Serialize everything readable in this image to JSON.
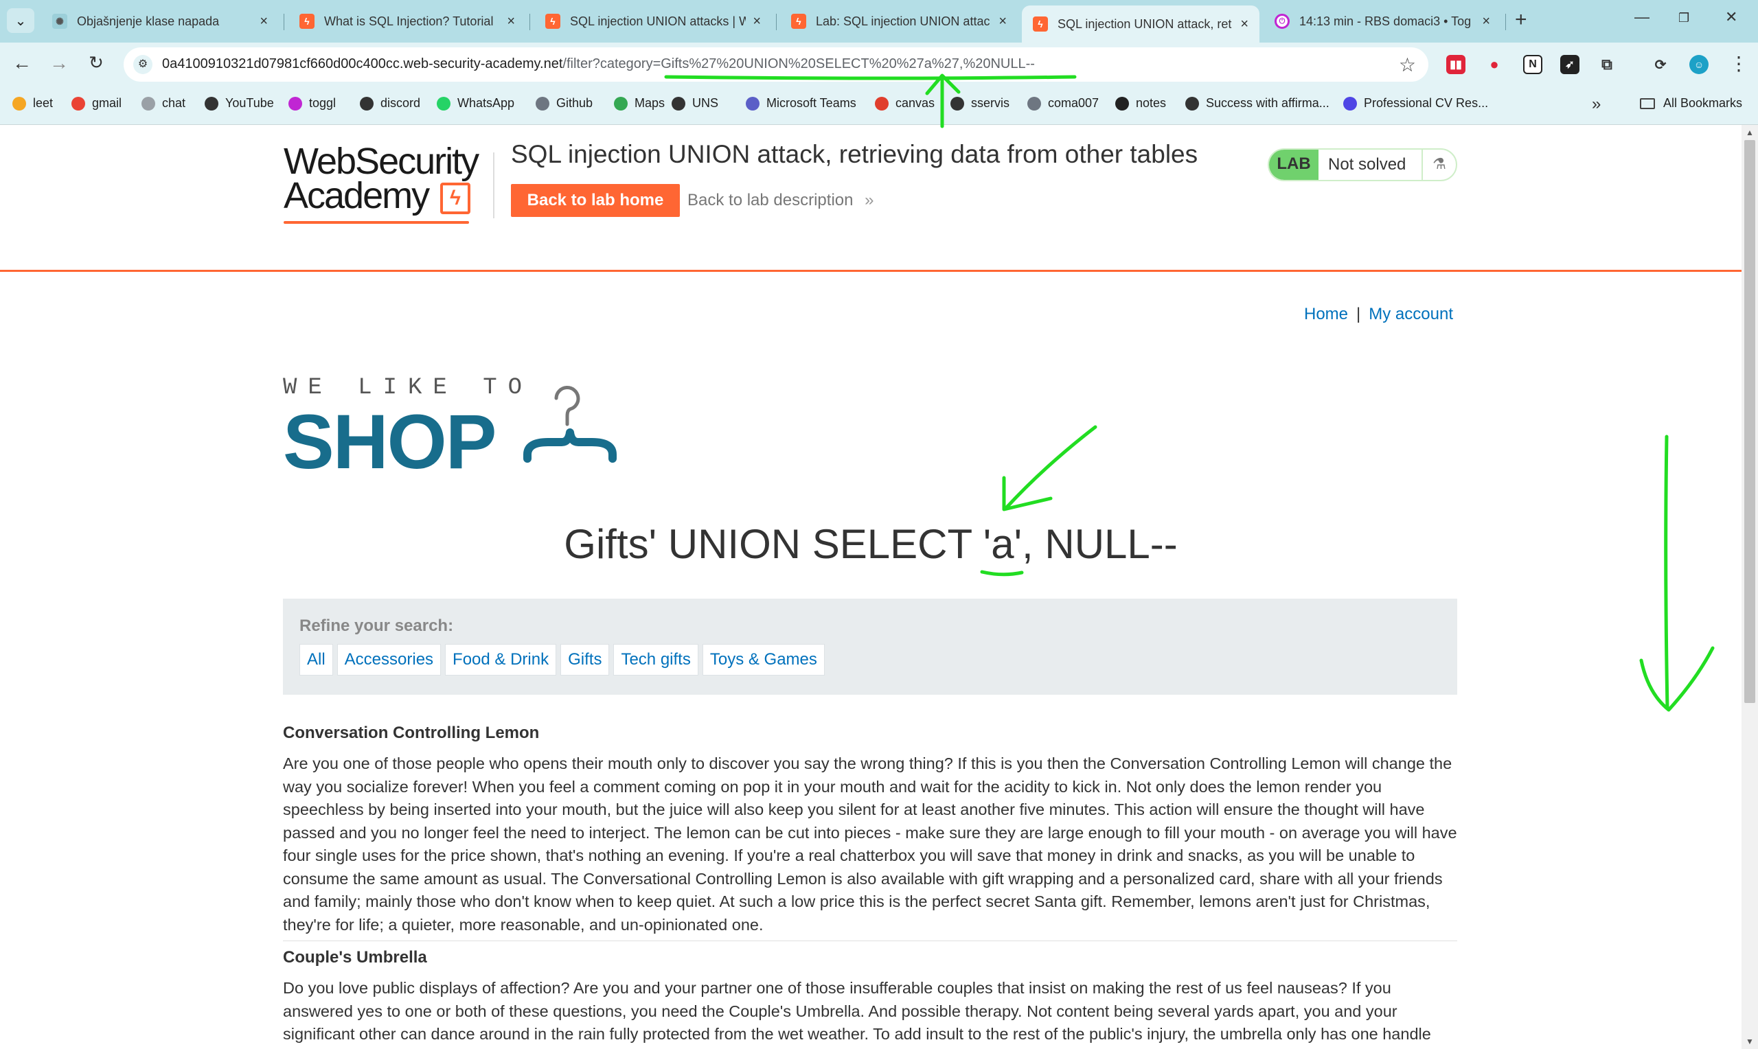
{
  "browser": {
    "tabs": [
      {
        "title": "Objašnjenje klase napada",
        "icon": "chatgpt-icon",
        "active": false
      },
      {
        "title": "What is SQL Injection? Tutorial",
        "icon": "portswigger-icon",
        "active": false
      },
      {
        "title": "SQL injection UNION attacks | W",
        "icon": "portswigger-icon",
        "active": false
      },
      {
        "title": "Lab: SQL injection UNION attac",
        "icon": "portswigger-icon",
        "active": false
      },
      {
        "title": "SQL injection UNION attack, ret",
        "icon": "portswigger-icon",
        "active": true
      },
      {
        "title": "14:13 min - RBS domaci3 • Tog",
        "icon": "toggl-icon",
        "active": false
      }
    ],
    "url_host": "0a4100910321d07981cf660d00c400cc.web-security-academy.net",
    "url_path": "/filter?category=Gifts%27%20UNION%20SELECT%20%27a%27,%20NULL--",
    "bookmarks": [
      {
        "label": "leet",
        "color": "#f5a623"
      },
      {
        "label": "gmail",
        "color": "#ea4335"
      },
      {
        "label": "chat",
        "color": "#9aa0a6"
      },
      {
        "label": "YouTube",
        "color": "#333333"
      },
      {
        "label": "toggl",
        "color": "#c026d3"
      },
      {
        "label": "discord",
        "color": "#333333"
      },
      {
        "label": "WhatsApp",
        "color": "#25d366"
      },
      {
        "label": "Github",
        "color": "#6e7681"
      },
      {
        "label": "Maps",
        "color": "#34a853"
      },
      {
        "label": "UNS",
        "color": "#333333"
      },
      {
        "label": "Microsoft Teams",
        "color": "#5b5fc7"
      },
      {
        "label": "canvas",
        "color": "#e03e2d"
      },
      {
        "label": "sservis",
        "color": "#333333"
      },
      {
        "label": "coma007",
        "color": "#6e7681"
      },
      {
        "label": "notes",
        "color": "#222222"
      },
      {
        "label": "Success with affirma...",
        "color": "#333333"
      },
      {
        "label": "Professional CV Res...",
        "color": "#4f46e5"
      }
    ],
    "all_bookmarks": "All Bookmarks"
  },
  "header": {
    "logo_line1": "WebSecurity",
    "logo_line2": "Academy",
    "lab_title": "SQL injection UNION attack, retrieving data from other tables",
    "back_button": "Back to lab home",
    "back_description": "Back to lab description",
    "lab_badge": "LAB",
    "lab_status": "Not solved"
  },
  "nav": {
    "home": "Home",
    "separator": "|",
    "account": "My account"
  },
  "shop_logo": {
    "tagline": "WE LIKE TO",
    "word": "SHOP"
  },
  "category_title": "Gifts' UNION SELECT 'a', NULL--",
  "filters": {
    "label": "Refine your search:",
    "items": [
      "All",
      "Accessories",
      "Food & Drink",
      "Gifts",
      "Tech gifts",
      "Toys & Games"
    ]
  },
  "products": [
    {
      "name": "Conversation Controlling Lemon",
      "description": "Are you one of those people who opens their mouth only to discover you say the wrong thing? If this is you then the Conversation Controlling Lemon will change the way you socialize forever! When you feel a comment coming on pop it in your mouth and wait for the acidity to kick in. Not only does the lemon render you speechless by being inserted into your mouth, but the juice will also keep you silent for at least another five minutes. This action will ensure the thought will have passed and you no longer feel the need to interject. The lemon can be cut into pieces - make sure they are large enough to fill your mouth - on average you will have four single uses for the price shown, that's nothing an evening. If you're a real chatterbox you will save that money in drink and snacks, as you will be unable to consume the same amount as usual. The Conversational Controlling Lemon is also available with gift wrapping and a personalized card, share with all your friends and family; mainly those who don't know when to keep quiet. At such a low price this is the perfect secret Santa gift. Remember, lemons aren't just for Christmas, they're for life; a quieter, more reasonable, and un-opinionated one."
    },
    {
      "name": "Couple's Umbrella",
      "description": "Do you love public displays of affection? Are you and your partner one of those insufferable couples that insist on making the rest of us feel nauseas? If you answered yes to one or both of these questions, you need the Couple's Umbrella. And possible therapy. Not content being several yards apart, you and your significant other can dance around in the rain fully protected from the wet weather. To add insult to the rest of the public's injury, the umbrella only has one handle"
    }
  ],
  "colors": {
    "accent": "#ff6633",
    "link": "#0071bc",
    "shop_blue": "#186d8c",
    "annotation": "#22dd22"
  }
}
